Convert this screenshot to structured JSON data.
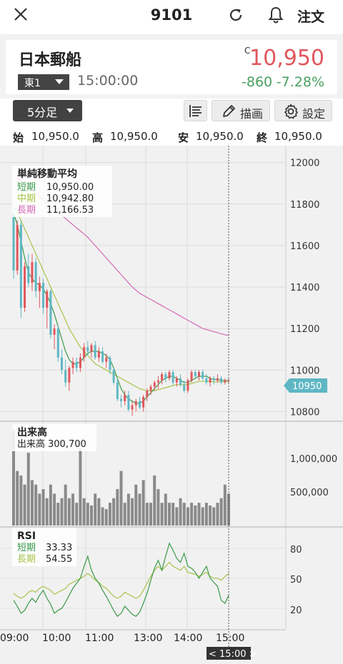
{
  "header": {
    "title": "9101",
    "order_label": "注文",
    "icons": {
      "close": "close-icon",
      "reload": "refresh-icon",
      "bell": "bell-icon"
    }
  },
  "stock": {
    "name": "日本郵船",
    "market": "東1",
    "time": "15:00:00",
    "price_flag": "C",
    "price": "10,950",
    "change": "-860",
    "change_pct": "-7.28%",
    "colors": {
      "up": "#e0565d",
      "down": "#4aa060"
    }
  },
  "toolbar": {
    "period": "5分足",
    "draw_label": "描画",
    "settings_label": "設定",
    "icons": {
      "list": "list-icon",
      "draw": "pencil-icon",
      "settings": "gear-icon"
    }
  },
  "ohlc": [
    {
      "key": "始",
      "value": "10,950.0"
    },
    {
      "key": "高",
      "value": "10,950.0"
    },
    {
      "key": "安",
      "value": "10,950.0"
    },
    {
      "key": "終",
      "value": "10,950.0"
    }
  ],
  "chart_data": {
    "type": "candlestick",
    "x_ticks": [
      "09:00",
      "10:00",
      "11:00",
      "13:00",
      "14:00",
      "15:00"
    ],
    "cursor_label": "< 15:00 >",
    "current_price_label": "10950",
    "price_axis": {
      "ticks": [
        "12000",
        "11800",
        "11600",
        "11400",
        "11200",
        "11000",
        "10800"
      ],
      "range": [
        10760,
        12040
      ]
    },
    "ma_legend": {
      "title": "単純移動平均",
      "items": [
        {
          "name": "短期",
          "value": "10,950.00",
          "color": "#3a9a4a"
        },
        {
          "name": "中期",
          "value": "10,942.80",
          "color": "#a8c44a"
        },
        {
          "name": "長期",
          "value": "11,166.53",
          "color": "#d46ab4"
        }
      ]
    },
    "candles": [
      [
        11750,
        11780,
        11440,
        11480
      ],
      [
        11480,
        11720,
        11460,
        11700
      ],
      [
        11700,
        11720,
        11250,
        11300
      ],
      [
        11300,
        11520,
        11280,
        11500
      ],
      [
        11500,
        11560,
        11400,
        11420
      ],
      [
        11420,
        11560,
        11380,
        11520
      ],
      [
        11520,
        11540,
        11350,
        11380
      ],
      [
        11380,
        11450,
        11300,
        11420
      ],
      [
        11420,
        11440,
        11270,
        11300
      ],
      [
        11300,
        11390,
        11200,
        11380
      ],
      [
        11380,
        11390,
        11150,
        11170
      ],
      [
        11170,
        11220,
        11100,
        11200
      ],
      [
        11200,
        11220,
        11040,
        11060
      ],
      [
        11060,
        11100,
        10980,
        11000
      ],
      [
        11000,
        11050,
        10920,
        10940
      ],
      [
        10940,
        11020,
        10900,
        11010
      ],
      [
        11010,
        11060,
        10980,
        11040
      ],
      [
        11040,
        11060,
        10990,
        11010
      ],
      [
        11010,
        11080,
        10990,
        11060
      ],
      [
        11060,
        11130,
        11040,
        11110
      ],
      [
        11110,
        11140,
        11070,
        11090
      ],
      [
        11090,
        11130,
        11060,
        11120
      ],
      [
        11120,
        11140,
        11050,
        11060
      ],
      [
        11060,
        11110,
        11040,
        11090
      ],
      [
        11090,
        11110,
        11030,
        11040
      ],
      [
        11040,
        11080,
        11010,
        11060
      ],
      [
        11060,
        11070,
        10980,
        11000
      ],
      [
        11000,
        11010,
        10930,
        10940
      ],
      [
        10940,
        10960,
        10850,
        10860
      ],
      [
        10860,
        10880,
        10820,
        10850
      ],
      [
        10850,
        10900,
        10830,
        10880
      ],
      [
        10880,
        10900,
        10800,
        10810
      ],
      [
        10810,
        10850,
        10780,
        10830
      ],
      [
        10830,
        10860,
        10800,
        10850
      ],
      [
        10850,
        10870,
        10810,
        10820
      ],
      [
        10820,
        10880,
        10800,
        10870
      ],
      [
        10870,
        10910,
        10850,
        10900
      ],
      [
        10900,
        10930,
        10880,
        10920
      ],
      [
        10920,
        10950,
        10900,
        10940
      ],
      [
        10940,
        10970,
        10910,
        10950
      ],
      [
        10950,
        10990,
        10930,
        10980
      ],
      [
        10980,
        10990,
        10940,
        10960
      ],
      [
        10960,
        11000,
        10950,
        10990
      ],
      [
        10990,
        11000,
        10930,
        10940
      ],
      [
        10940,
        10970,
        10920,
        10960
      ],
      [
        10960,
        10980,
        10920,
        10930
      ],
      [
        10930,
        10950,
        10890,
        10900
      ],
      [
        10900,
        10960,
        10890,
        10950
      ],
      [
        10950,
        11000,
        10940,
        10990
      ],
      [
        10990,
        11000,
        10960,
        10970
      ],
      [
        10970,
        11000,
        10950,
        10990
      ],
      [
        10990,
        11000,
        10950,
        10960
      ],
      [
        10960,
        10980,
        10930,
        10940
      ],
      [
        10940,
        10970,
        10920,
        10960
      ],
      [
        10960,
        10970,
        10930,
        10950
      ],
      [
        10950,
        10980,
        10940,
        10960
      ],
      [
        10960,
        10970,
        10930,
        10940
      ],
      [
        10940,
        10960,
        10930,
        10950
      ],
      [
        10950,
        10960,
        10940,
        10950
      ]
    ],
    "ma_short": [
      11760,
      11700,
      11620,
      11540,
      11470,
      11440,
      11420,
      11410,
      11390,
      11360,
      11320,
      11270,
      11210,
      11150,
      11090,
      11050,
      11030,
      11030,
      11040,
      11060,
      11080,
      11090,
      11090,
      11090,
      11080,
      11070,
      11050,
      11010,
      10960,
      10910,
      10880,
      10860,
      10850,
      10840,
      10840,
      10850,
      10870,
      10890,
      10910,
      10930,
      10950,
      10960,
      10970,
      10970,
      10960,
      10950,
      10940,
      10940,
      10950,
      10960,
      10970,
      10970,
      10970,
      10960,
      10955,
      10955,
      10950,
      10950,
      10950
    ],
    "ma_mid": [
      11790,
      11760,
      11720,
      11680,
      11640,
      11600,
      11560,
      11520,
      11480,
      11440,
      11400,
      11360,
      11320,
      11280,
      11240,
      11200,
      11170,
      11140,
      11110,
      11090,
      11070,
      11050,
      11030,
      11020,
      11010,
      11000,
      10990,
      10980,
      10970,
      10960,
      10950,
      10940,
      10930,
      10920,
      10910,
      10905,
      10900,
      10900,
      10900,
      10905,
      10910,
      10915,
      10920,
      10925,
      10930,
      10930,
      10930,
      10930,
      10935,
      10940,
      10945,
      10945,
      10945,
      10945,
      10943,
      10943,
      10943,
      10943,
      10943
    ],
    "ma_long": [
      11940,
      11925,
      11910,
      11895,
      11880,
      11865,
      11850,
      11835,
      11820,
      11805,
      11790,
      11775,
      11760,
      11745,
      11730,
      11715,
      11700,
      11685,
      11670,
      11655,
      11640,
      11620,
      11600,
      11580,
      11560,
      11540,
      11520,
      11500,
      11480,
      11460,
      11440,
      11420,
      11400,
      11385,
      11370,
      11360,
      11350,
      11340,
      11330,
      11320,
      11310,
      11300,
      11290,
      11280,
      11270,
      11260,
      11250,
      11240,
      11230,
      11220,
      11210,
      11200,
      11195,
      11190,
      11185,
      11180,
      11175,
      11170,
      11167
    ],
    "volume_panel": {
      "title": "出来高",
      "label": "出来高",
      "value": "300,700",
      "ticks": [
        "1,000,000",
        "500,000"
      ],
      "range": [
        0,
        1100000
      ],
      "values": [
        1050000,
        600000,
        550000,
        450000,
        800000,
        500000,
        450000,
        350000,
        400000,
        300000,
        450000,
        350000,
        250000,
        300000,
        450000,
        300000,
        350000,
        250000,
        850000,
        300000,
        250000,
        220000,
        350000,
        300000,
        200000,
        180000,
        250000,
        300000,
        400000,
        600000,
        250000,
        350000,
        300000,
        450000,
        350000,
        500000,
        250000,
        250000,
        550000,
        400000,
        250000,
        350000,
        250000,
        250000,
        200000,
        300000,
        250000,
        200000,
        250000,
        220000,
        250000,
        200000,
        250000,
        220000,
        200000,
        250000,
        300000,
        450000,
        350000
      ]
    },
    "rsi_panel": {
      "title": "RSI",
      "items": [
        {
          "name": "短期",
          "value": "33.33",
          "color": "#3a9a4a"
        },
        {
          "name": "長期",
          "value": "54.55",
          "color": "#a8c44a"
        }
      ],
      "ticks": [
        "80",
        "50",
        "20"
      ],
      "range": [
        0,
        100
      ],
      "short": [
        28,
        22,
        15,
        18,
        25,
        30,
        26,
        33,
        38,
        30,
        24,
        15,
        18,
        20,
        26,
        33,
        40,
        45,
        50,
        62,
        72,
        58,
        50,
        45,
        38,
        32,
        25,
        18,
        12,
        15,
        22,
        18,
        14,
        12,
        16,
        25,
        35,
        48,
        60,
        68,
        58,
        72,
        85,
        78,
        70,
        66,
        75,
        62,
        60,
        56,
        50,
        56,
        62,
        50,
        46,
        42,
        28,
        25,
        33
      ],
      "long": [
        35,
        32,
        30,
        32,
        36,
        38,
        36,
        40,
        42,
        40,
        38,
        34,
        36,
        38,
        40,
        44,
        46,
        48,
        50,
        52,
        55,
        52,
        48,
        46,
        42,
        40,
        36,
        32,
        30,
        32,
        36,
        34,
        32,
        30,
        32,
        38,
        45,
        52,
        58,
        62,
        58,
        62,
        66,
        62,
        60,
        58,
        62,
        56,
        55,
        54,
        52,
        54,
        56,
        52,
        50,
        50,
        48,
        52,
        55
      ]
    }
  }
}
